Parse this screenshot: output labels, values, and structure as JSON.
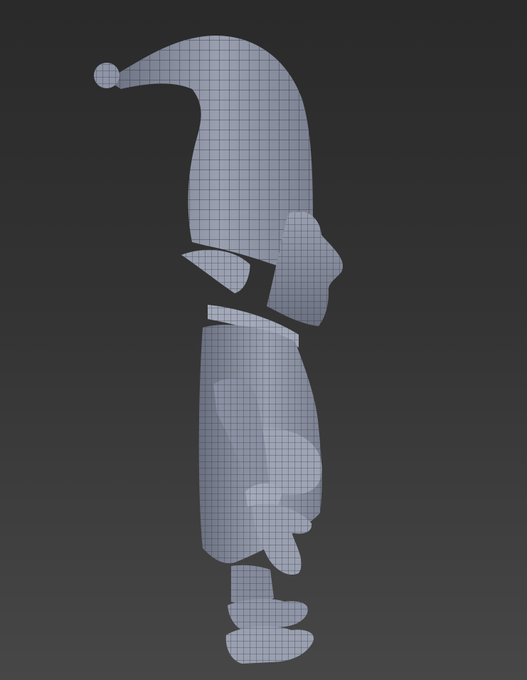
{
  "viewport": {
    "background_top": "#2a2a2a",
    "background_bottom": "#474747"
  },
  "model": {
    "type": "wireframe-3d-character",
    "subject": "gnome",
    "mesh_fill": "#8f95a6",
    "mesh_shadow": "#6b7080",
    "mesh_highlight": "#b4b9c8",
    "wire_color": "#2b2f3a"
  }
}
